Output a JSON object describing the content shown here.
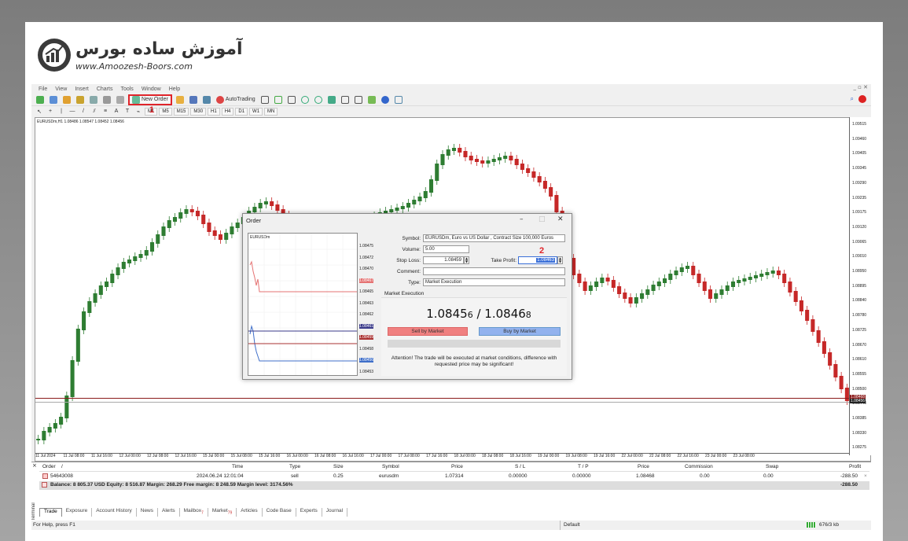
{
  "branding": {
    "logo_fa": "آموزش ساده بورس",
    "logo_en": "www.Amoozesh-Boors.com"
  },
  "menu": [
    "File",
    "View",
    "Insert",
    "Charts",
    "Tools",
    "Window",
    "Help"
  ],
  "toolbar": {
    "new_order": "New Order",
    "autotrading": "AutoTrading"
  },
  "timeframes": [
    "M1",
    "M5",
    "M15",
    "M30",
    "H1",
    "H4",
    "D1",
    "W1",
    "MN"
  ],
  "chart": {
    "header": "EURUSDm,H1  1.08486 1.08547 1.08452 1.08456",
    "price_labels": [
      "1.09515",
      "1.09460",
      "1.09405",
      "1.09345",
      "1.09290",
      "1.09235",
      "1.09175",
      "1.09120",
      "1.09065",
      "1.09010",
      "1.08950",
      "1.08895",
      "1.08840",
      "1.08780",
      "1.08725",
      "1.08670",
      "1.08610",
      "1.08555",
      "1.08500",
      "1.08440",
      "1.08385",
      "1.08330",
      "1.08275"
    ],
    "time_labels": [
      "11 Jul 2024",
      "11 Jul 08:00",
      "11 Jul 16:00",
      "12 Jul 00:00",
      "12 Jul 08:00",
      "12 Jul 16:00",
      "15 Jul 00:00",
      "15 Jul 08:00",
      "15 Jul 16:00",
      "16 Jul 00:00",
      "16 Jul 08:00",
      "16 Jul 16:00",
      "17 Jul 00:00",
      "17 Jul 08:00",
      "17 Jul 16:00",
      "18 Jul 00:00",
      "18 Jul 08:00",
      "18 Jul 16:00",
      "19 Jul 00:00",
      "19 Jul 08:00",
      "19 Jul 16:00",
      "22 Jul 00:00",
      "22 Jul 08:00",
      "22 Jul 16:00",
      "23 Jul 00:00",
      "23 Jul 08:00"
    ],
    "current_price_tags": [
      "1.08468",
      "1.08456"
    ],
    "colors": {
      "bull": "#2e7d32",
      "bear": "#c62828"
    }
  },
  "dialog": {
    "title": "Order",
    "mini_chart_symbol": "EURUSDm",
    "mini_prices": [
      "1.08475",
      "1.08472",
      "1.08470",
      "1.08467",
      "1.08465",
      "1.08463",
      "1.08462",
      "1.08461",
      "1.08459",
      "1.08458",
      "1.08456",
      "1.08453"
    ],
    "symbol_label": "Symbol:",
    "symbol_value": "EURUSDm, Euro vs US Dollar , Contract Size 100,000 Euros",
    "volume_label": "Volume:",
    "volume_value": "5.00",
    "stop_loss_label": "Stop Loss:",
    "stop_loss_value": "1.08459",
    "take_profit_label": "Take Profit:",
    "take_profit_value": "1.08463",
    "comment_label": "Comment:",
    "comment_value": "",
    "type_label": "Type:",
    "type_value": "Market Execution",
    "section": "Market Execution",
    "bid": "1.0845",
    "bid_small": "6",
    "ask": "1.0846",
    "ask_small": "8",
    "sell_button": "Sell by Market",
    "buy_button": "Buy by Market",
    "attention": "Attention! The trade will be executed at market conditions, difference with requested price may be significant!"
  },
  "annotations": {
    "one": "1",
    "two": "2"
  },
  "terminal": {
    "headers": [
      "Order",
      "/",
      "Time",
      "Type",
      "Size",
      "Symbol",
      "Price",
      "S / L",
      "T / P",
      "Price",
      "Commission",
      "Swap",
      "Profit"
    ],
    "row": [
      "54643008",
      "2024.06.24 12:01:04",
      "sell",
      "0.25",
      "eurusdm",
      "1.07314",
      "0.00000",
      "0.00000",
      "1.08468",
      "0.00",
      "0.00",
      "-288.50"
    ],
    "balance": "Balance: 8 805.37 USD  Equity: 8 516.87  Margin: 268.29  Free margin: 8 248.59  Margin level: 3174.56%",
    "balance_profit": "-288.50",
    "tabs": [
      "Trade",
      "Exposure",
      "Account History",
      "News",
      "Alerts",
      "Mailbox",
      "Market",
      "Articles",
      "Code Base",
      "Experts",
      "Journal"
    ],
    "mailbox_badge": "7",
    "market_badge": "79",
    "side_label": "Terminal"
  },
  "status": {
    "help": "For Help, press F1",
    "profile": "Default",
    "traffic": "676/3 kb"
  }
}
